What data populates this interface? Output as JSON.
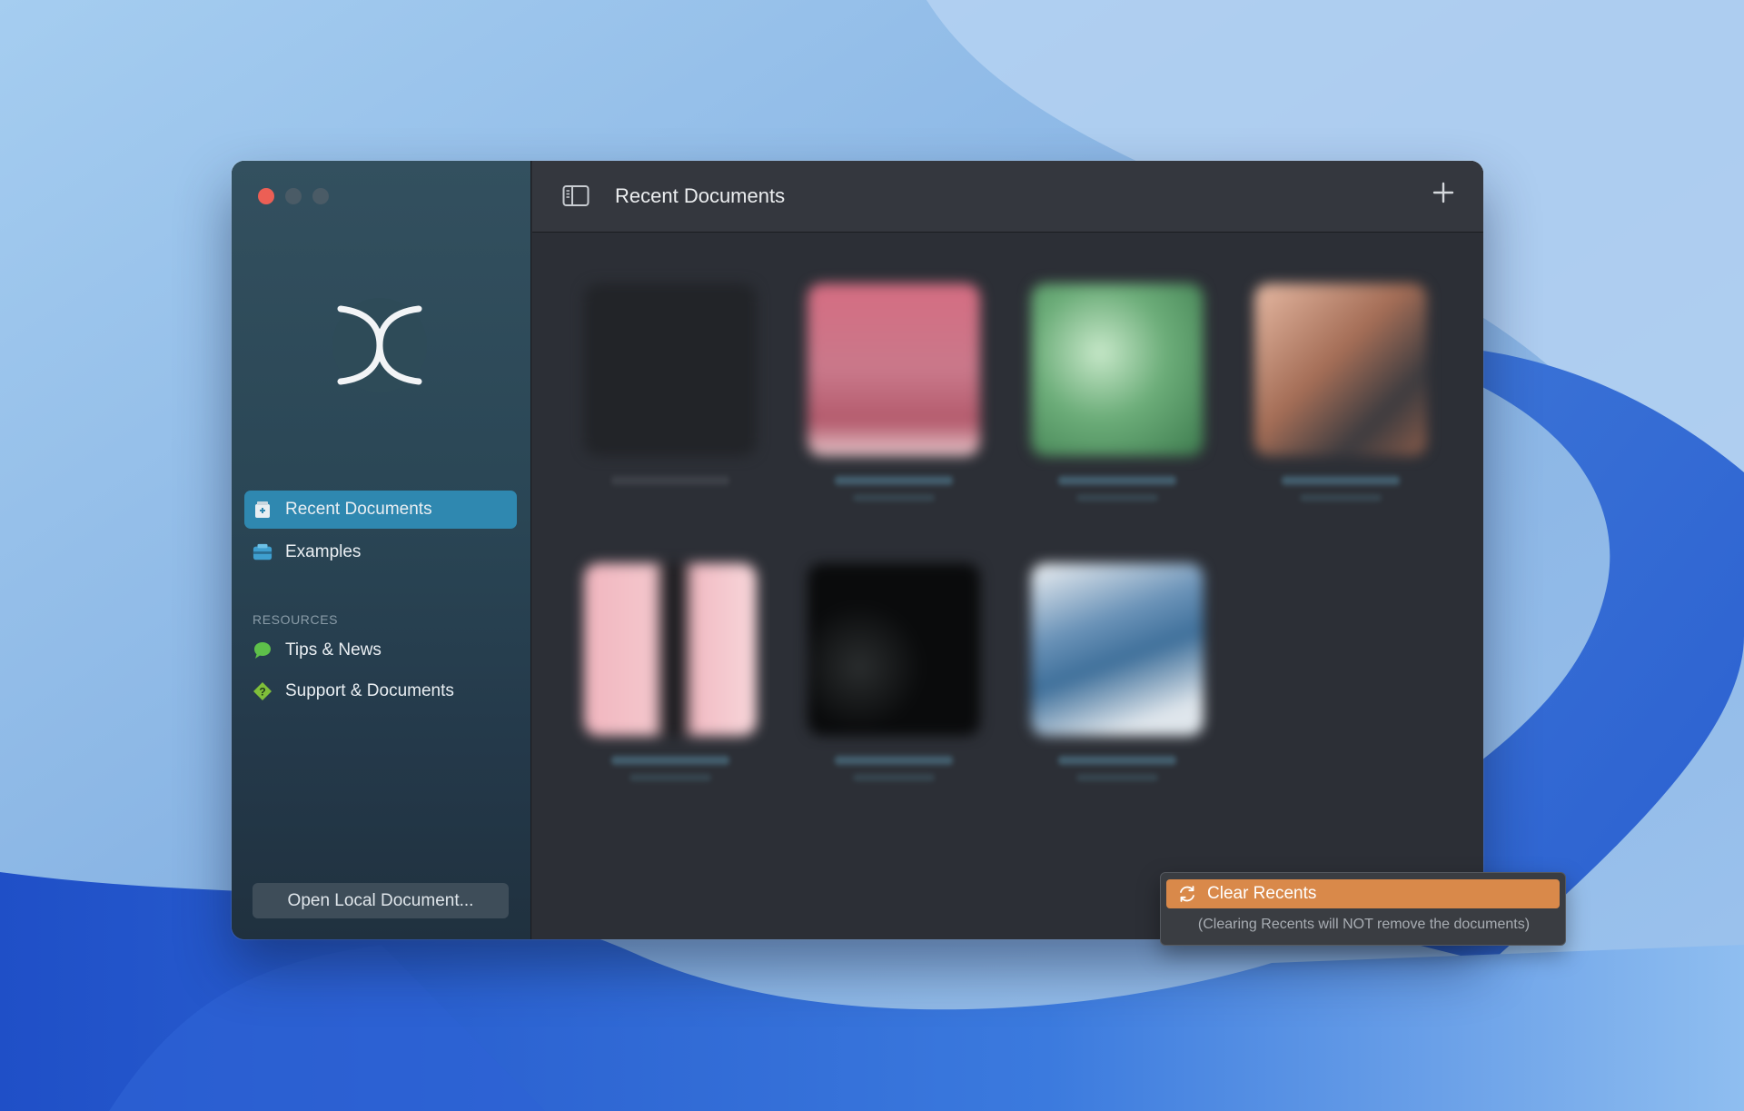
{
  "window": {
    "title": "Recent Documents"
  },
  "sidebar": {
    "items": [
      {
        "label": "Recent Documents",
        "icon": "recent-documents-icon",
        "active": true
      },
      {
        "label": "Examples",
        "icon": "examples-icon",
        "active": false
      }
    ],
    "resources_label": "RESOURCES",
    "resources": [
      {
        "label": "Tips & News",
        "icon": "speech-bubble-icon"
      },
      {
        "label": "Support & Documents",
        "icon": "question-diamond-icon"
      }
    ],
    "open_button": "Open Local Document..."
  },
  "documents": [
    {
      "thumbnail": "dark-empty-canvas"
    },
    {
      "thumbnail": "pink-texture"
    },
    {
      "thumbnail": "green-foliage"
    },
    {
      "thumbnail": "building-facade"
    },
    {
      "thumbnail": "pink-silhouette"
    },
    {
      "thumbnail": "bicycle-on-black"
    },
    {
      "thumbnail": "blue-white-collage"
    }
  ],
  "popup": {
    "button_label": "Clear Recents",
    "note": "(Clearing Recents will NOT remove the documents)"
  },
  "colors": {
    "accent": "#2f88b0",
    "popup_button": "#d9894a",
    "close": "#ec5f55"
  }
}
